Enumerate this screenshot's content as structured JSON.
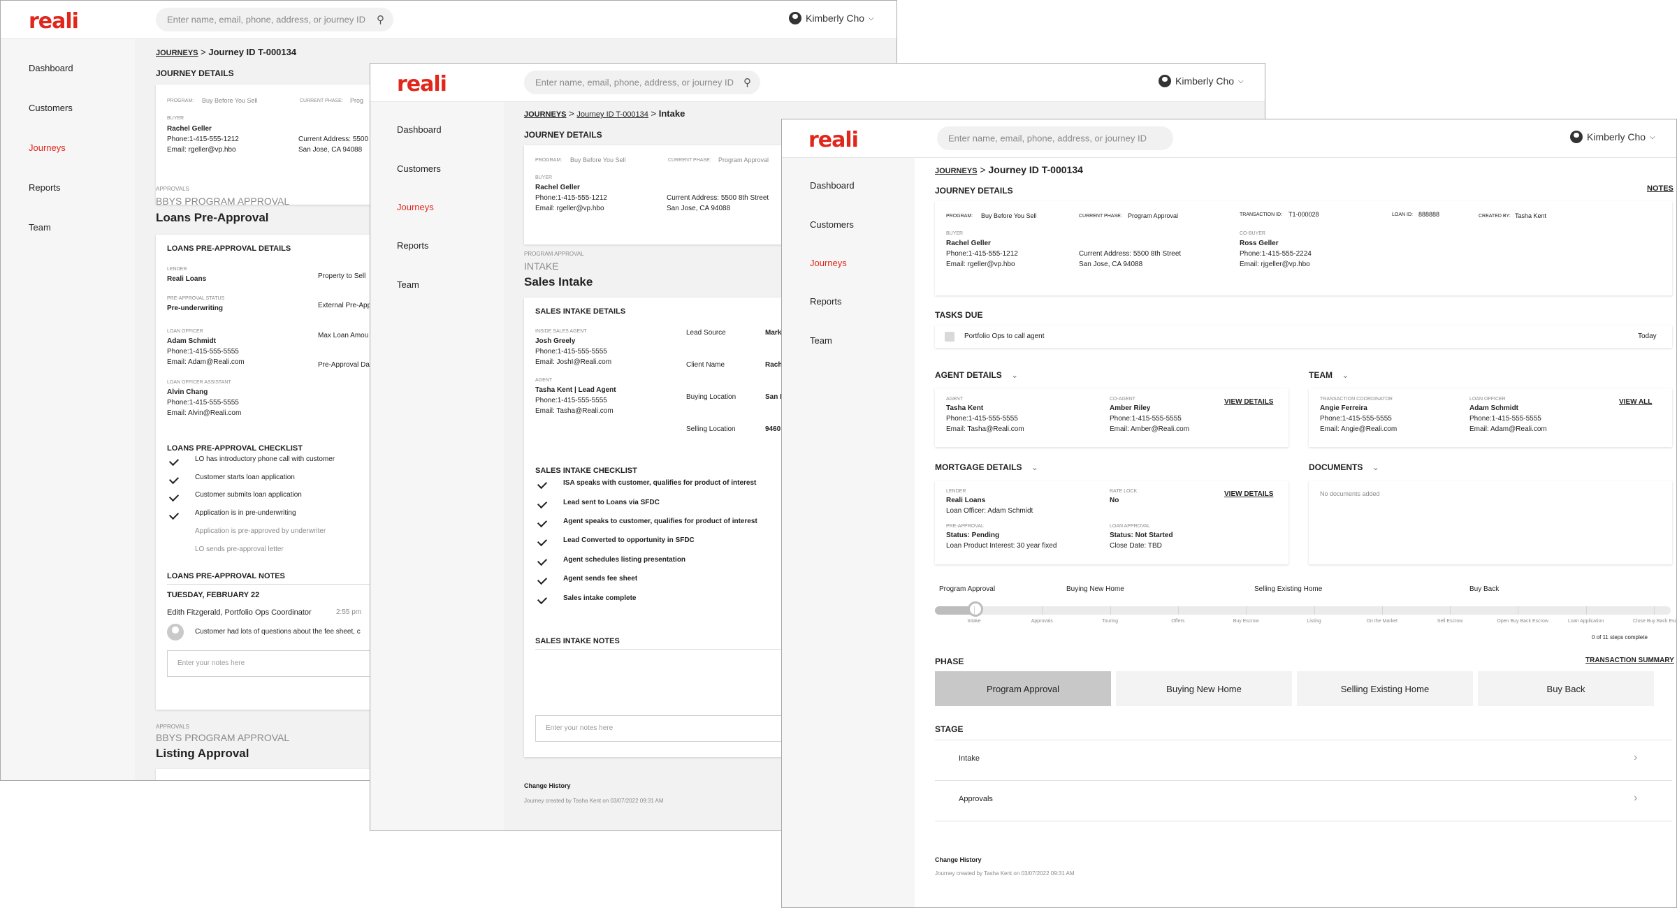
{
  "brand": {
    "logo": "reali",
    "accent": "#e1261c"
  },
  "search_placeholder": "Enter name, email, phone, address, or journey ID",
  "user_name": "Kimberly Cho",
  "nav": [
    "Dashboard",
    "Customers",
    "Journeys",
    "Reports",
    "Team"
  ],
  "journey": {
    "breadcrumb_root": "JOURNEYS",
    "breadcrumb_id": "Journey ID T-000134",
    "breadcrumb_sep": ">",
    "title": "JOURNEY DETAILS",
    "program_label": "PROGRAM:",
    "program_value": "Buy Before You Sell",
    "phase_label": "CURRENT PHASE:",
    "phase_value": "Program Approval",
    "phase_value_short": "Prog",
    "transaction_label": "TRANSACTION ID:",
    "transaction_value": "T1-000028",
    "loan_label": "LOAN ID:",
    "loan_value": "888888",
    "created_label": "CREATED BY:",
    "created_value": "Tasha Kent",
    "notes_link": "NOTES",
    "buyer_label": "BUYER",
    "buyer_name": "Rachel Geller",
    "buyer_phone": "Phone:1-415-555-1212",
    "buyer_email": "Email: rgeller@vp.hbo",
    "address_line1": "Current Address: 5500 8th Street",
    "address_line2": "San Jose, CA 94088",
    "address_line1_short": "Current Address: 5500",
    "cobuyer_label": "CO-BUYER",
    "cobuyer_name": "Ross Geller",
    "cobuyer_phone": "Phone:1-415-555-2224",
    "cobuyer_email": "Email: rjgeller@vp.hbo"
  },
  "screen1": {
    "approvals_label": "APPROVALS",
    "program_approval": "BBYS PROGRAM APPROVAL",
    "loans_title": "Loans Pre-Approval",
    "loans_details_title": "LOANS PRE-APPROVAL DETAILS",
    "lender_label": "LENDER",
    "lender_value": "Reali Loans",
    "status_label": "PRE-APPROVAL STATUS",
    "status_value": "Pre-underwriting",
    "lo_label": "LOAN OFFICER",
    "lo_name": "Adam Schmidt",
    "lo_phone": "Phone:1-415-555-5555",
    "lo_email": "Email: Adam@Reali.com",
    "loa_label": "LOAN OFFICER ASSISTANT",
    "loa_name": "Alvin Chang",
    "loa_phone": "Phone:1-415-555-5555",
    "loa_email": "Email: Alvin@Reali.com",
    "right_labels": [
      "Property to Sell",
      "External Pre-App",
      "Max Loan Amou",
      "Pre-Approval Da"
    ],
    "checklist_title": "LOANS PRE-APPROVAL CHECKLIST",
    "checklist": [
      {
        "text": "LO has introductory phone call with customer",
        "done": true
      },
      {
        "text": "Customer starts loan application",
        "done": true
      },
      {
        "text": "Customer submits loan application",
        "done": true
      },
      {
        "text": "Application is in pre-underwriting",
        "done": true
      },
      {
        "text": "Application is pre-approved by underwriter",
        "done": false
      },
      {
        "text": "LO sends pre-approval letter",
        "done": false
      }
    ],
    "notes_title": "LOANS PRE-APPROVAL NOTES",
    "note_date": "TUESDAY, FEBRUARY 22",
    "note_author": "Edith Fitzgerald, Portfolio Ops Coordinator",
    "note_time": "2:55 pm",
    "note_text": "Customer had lots of questions about the fee sheet, c",
    "notes_placeholder": "Enter your notes here",
    "approvals_label2": "APPROVALS",
    "program_approval2": "BBYS PROGRAM APPROVAL",
    "listing_title": "Listing Approval"
  },
  "screen2": {
    "breadcrumb_stage": "Intake",
    "program_approval_label": "PROGRAM APPROVAL",
    "intake_label": "INTAKE",
    "sales_title": "Sales Intake",
    "sales_details_title": "SALES INTAKE DETAILS",
    "isa_label": "INSIDE SALES AGENT",
    "isa_name": "Josh Greely",
    "isa_phone": "Phone:1-415-555-5555",
    "isa_email": "Email: JoshI@Reali.com",
    "agent_label": "AGENT",
    "agent_name": "Tasha Kent | Lead Agent",
    "agent_phone": "Phone:1-415-555-5555",
    "agent_email": "Email: Tasha@Reali.com",
    "right_labels": [
      "Lead Source",
      "Client Name",
      "Buying Location",
      "Selling Location"
    ],
    "right_values": [
      "Mark",
      "Rach",
      "San M",
      "9460"
    ],
    "checklist_title": "SALES INTAKE CHECKLIST",
    "checklist": [
      "ISA speaks with customer, qualifies for product of interest",
      "Lead sent to Loans via SFDC",
      "Agent speaks to customer, qualifies for product of interest",
      "Lead Converted to opportunity in SFDC",
      "Agent schedules listing presentation",
      "Agent sends fee sheet",
      "Sales intake complete"
    ],
    "notes_title": "SALES INTAKE NOTES",
    "notes_placeholder": "Enter your notes here",
    "change_history": "Change History",
    "created_text": "Journey created by Tasha Kent on 03/07/2022 09:31 AM"
  },
  "screen3": {
    "tasks_title": "TASKS DUE",
    "task_text": "Portfolio Ops to call agent",
    "task_due": "Today",
    "agent_title": "AGENT DETAILS",
    "agent_label": "AGENT",
    "agent_name": "Tasha Kent",
    "agent_phone": "Phone:1-415-555-5555",
    "agent_email": "Email: Tasha@Reali.com",
    "coagent_label": "CO-AGENT",
    "coagent_name": "Amber Riley",
    "coagent_phone": "Phone:1-415-555-5555",
    "coagent_email": "Email: Amber@Reali.com",
    "view_details": "VIEW DETAILS",
    "team_title": "TEAM",
    "tc_label": "TRANSACTION COORDINATOR",
    "tc_name": "Angie Ferreira",
    "tc_phone": "Phone:1-415-555-5555",
    "tc_email": "Email: Angie@Reali.com",
    "lo_label": "LOAN OFFICER",
    "lo_name": "Adam Schmidt",
    "lo_phone": "Phone:1-415-555-5555",
    "lo_email": "Email: Adam@Reali.com",
    "view_all": "VIEW ALL",
    "mortgage_title": "MORTGAGE DETAILS",
    "lender_label": "LENDER",
    "lender_name": "Reali Loans",
    "lender_officer": "Loan Officer: Adam Schmidt",
    "rate_label": "RATE LOCK",
    "rate_value": "No",
    "preapproval_label": "PRE-APPROVAL",
    "preapproval_status": "Status: Pending",
    "preapproval_interest": "Loan Product Interest: 30 year fixed",
    "loanapproval_label": "LOAN APPROVAL",
    "loanapproval_status": "Status: Not Started",
    "loanapproval_close": "Close Date: TBD",
    "documents_title": "DOCUMENTS",
    "no_documents": "No documents added",
    "progress_groups": [
      "Program Approval",
      "Buying New Home",
      "Selling Existing Home",
      "Buy Back"
    ],
    "progress_steps": [
      "Intake",
      "Approvals",
      "Touring",
      "Offers",
      "Buy Escrow",
      "Listing",
      "On the Market",
      "Sell Escrow",
      "Open Buy Back Escrow",
      "Loan Application",
      "Close Buy Back Escrow"
    ],
    "progress_fraction": 0.055,
    "steps_complete": "0 of 11 steps complete",
    "phase_title": "PHASE",
    "transaction_summary": "TRANSACTION SUMMARY",
    "phases": [
      "Program Approval",
      "Buying New Home",
      "Selling Existing Home",
      "Buy Back"
    ],
    "stage_title": "STAGE",
    "stages": [
      "Intake",
      "Approvals"
    ],
    "change_history": "Change History",
    "created_text": "Journey created by Tasha Kent on 03/07/2022 09:31 AM"
  }
}
